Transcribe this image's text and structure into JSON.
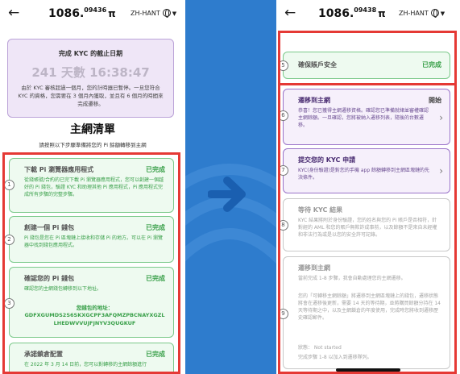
{
  "left": {
    "balance_int": "1086.",
    "balance_dec": "09436",
    "pi": "π",
    "lang": "ZH-HANT",
    "kyc_title": "完成 KYC 的截止日期",
    "countdown": "241 天數 16:38:47",
    "kyc_desc": "由於 KYC 審核超過一個月，您的計時器已暫停。一旦您符合 KYC 的資格，您需要在 3 個月內獲取，並且有 6 個月的時間來完成遷移。",
    "checklist_title": "主網清單",
    "checklist_sub": "請按照以下步驟準備將您的 Pi 餘額轉移到主網",
    "cards": [
      {
        "num": "1",
        "title": "下載 Pi 瀏覽器應用程式",
        "status": "已完成",
        "body": "從錢帳號/合約的已完下載 Pi 瀏覽器應用程式，您可以創建一個越好的 Pi 錢包，驗證 KYC 和助理其他 Pi 應用程式，Pi 應用程式完成所有步驟的完整步驟。"
      },
      {
        "num": "2",
        "title": "創建一個 Pi 錢包",
        "status": "已完成",
        "body": "Pi 錢包是您在 Pi 區塊鏈上接收和存儲 Pi 的地方。可以在 Pi 瀏覽器中找到錢包應用程式。"
      },
      {
        "num": "3",
        "title": "確認您的 Pi 錢包",
        "status": "已完成",
        "body": "確認您的主網錢包轉移到以下地址。",
        "addr_label": "您錢包的地址：",
        "address": "GDFXGUMDS2S6SKXGCPF3AFQMZPBCNAYXGZLLHEDWVVUJFJNYV3QUGKUF"
      },
      {
        "num": "4",
        "title": "承諾鎖倉配置",
        "status": "已完成",
        "body": "在 2022 年 3 月 14 日前，您可以對轉移的主網餘額進行"
      }
    ]
  },
  "right": {
    "balance_int": "1086.",
    "balance_dec": "09438",
    "pi": "π",
    "lang": "ZH-HANT",
    "cards": [
      {
        "num": "5",
        "title": "確保賬戶安全",
        "status": "已完成",
        "body": ""
      },
      {
        "num": "6",
        "title": "遷移到主網",
        "status": "開始",
        "body": "恭喜！您已獲得主網遷移資格。確認您已準備就緒並審權確認主網餘額。一旦確認，您將被納入遷移列表，隨後的台數遷移。"
      },
      {
        "num": "7",
        "title": "提交您的 KYC 申請",
        "status": "",
        "body": "KYC(身份驗證)是對您的手機 app 餘額轉移到主網區塊鏈的先決條件。"
      },
      {
        "num": "8",
        "title": "等待 KYC 結果",
        "status": "",
        "body": "KYC 結果將附於身份驗證，您的姓名與您的 Pi 賬戶是否相符，針對經的 AML 和您的賬戶無欺詐成事前，以及餘額不是來自未經權和非法行為或是以您的安全許可記錄。"
      },
      {
        "num": "9",
        "title": "遷移到主網",
        "status": "",
        "body": "當前完成 1-8 步驟，我會自動處理您的主網遷移。",
        "body2": "您的「可轉移主網餘額」將遷移到主網區塊鏈上的錢包，遷移狀態將會在遷移後更新，需要 14 天的等待期，並將購買餘額分持在 14 天等待期之中，以及主網鎖倉的年度使用，完成時您將收到遷移歷史確認郵件。",
        "status_line": "狀態： Not started",
        "body3": "完成步驟 1-8 以加入到遷移隊列。"
      }
    ]
  }
}
